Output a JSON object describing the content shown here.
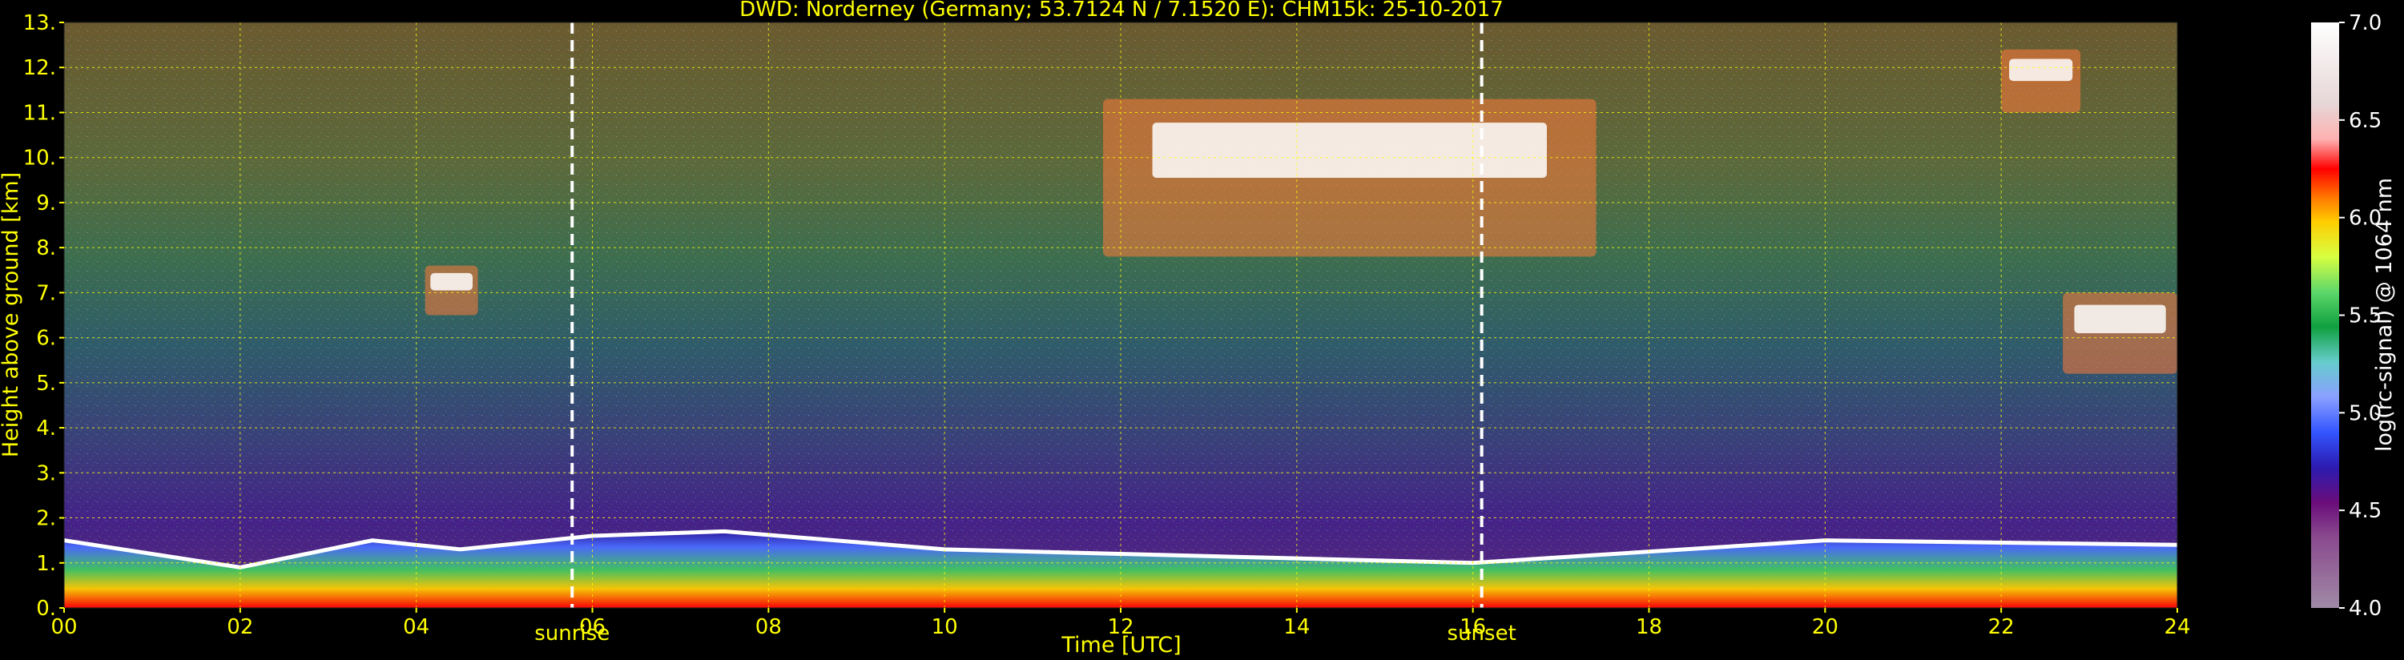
{
  "chart_data": {
    "type": "heatmap",
    "title": "DWD: Norderney (Germany; 53.7124 N / 7.1520 E):    CHM15k: 25-10-2017",
    "xlabel": "Time [UTC]",
    "ylabel": "Height above ground [km]",
    "colorbar_label": "log(rc-signal) @ 1064 nm",
    "xlim": [
      0,
      24
    ],
    "ylim": [
      0,
      13
    ],
    "x_ticks": [
      "00",
      "02",
      "04",
      "06",
      "08",
      "10",
      "12",
      "14",
      "16",
      "18",
      "20",
      "22",
      "24"
    ],
    "y_ticks": [
      "0.",
      "1.",
      "2.",
      "3.",
      "4.",
      "5.",
      "6.",
      "7.",
      "8.",
      "9.",
      "10.",
      "11.",
      "12.",
      "13."
    ],
    "colorbar_range": [
      4.0,
      7.0
    ],
    "colorbar_ticks": [
      "4.0",
      "4.5",
      "5.0",
      "5.5",
      "6.0",
      "6.5",
      "7.0"
    ],
    "grid": true,
    "annotations": [
      {
        "label": "sunrise",
        "x": 5.77
      },
      {
        "label": "sunset",
        "x": 16.1
      }
    ],
    "features": {
      "boundary_layer_top_km": [
        {
          "x": 0,
          "y": 1.5
        },
        {
          "x": 2,
          "y": 0.9
        },
        {
          "x": 3.5,
          "y": 1.5
        },
        {
          "x": 4.5,
          "y": 1.3
        },
        {
          "x": 6,
          "y": 1.6
        },
        {
          "x": 7.5,
          "y": 1.7
        },
        {
          "x": 10,
          "y": 1.3
        },
        {
          "x": 12,
          "y": 1.2
        },
        {
          "x": 14,
          "y": 1.1
        },
        {
          "x": 16,
          "y": 1.0
        },
        {
          "x": 20,
          "y": 1.5
        },
        {
          "x": 24,
          "y": 1.4
        }
      ],
      "cloud_layers": [
        {
          "x_start": 4.1,
          "x_end": 4.7,
          "y_bottom": 6.5,
          "y_top": 7.6
        },
        {
          "x_start": 11.8,
          "x_end": 17.4,
          "y_bottom": 7.8,
          "y_top": 11.3
        },
        {
          "x_start": 22.0,
          "x_end": 22.9,
          "y_bottom": 11.0,
          "y_top": 12.4
        },
        {
          "x_start": 22.7,
          "x_end": 24.0,
          "y_bottom": 5.2,
          "y_top": 7.0
        }
      ]
    }
  },
  "colors": {
    "background": "#000000",
    "text": "#ffff00",
    "grid": "#ffff00",
    "colorbar_text": "#ffffff"
  }
}
